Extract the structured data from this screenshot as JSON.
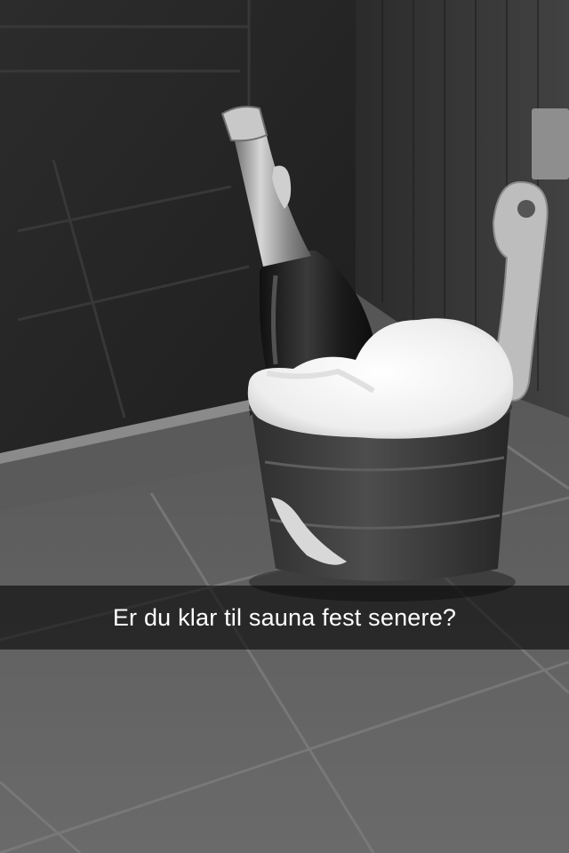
{
  "snap": {
    "caption": "Er du klar til sauna fest senere?",
    "photo_subject": "champagne bottle in ice bucket on tiled floor"
  },
  "colors": {
    "caption_bar": "#000000",
    "caption_text": "#ffffff"
  }
}
